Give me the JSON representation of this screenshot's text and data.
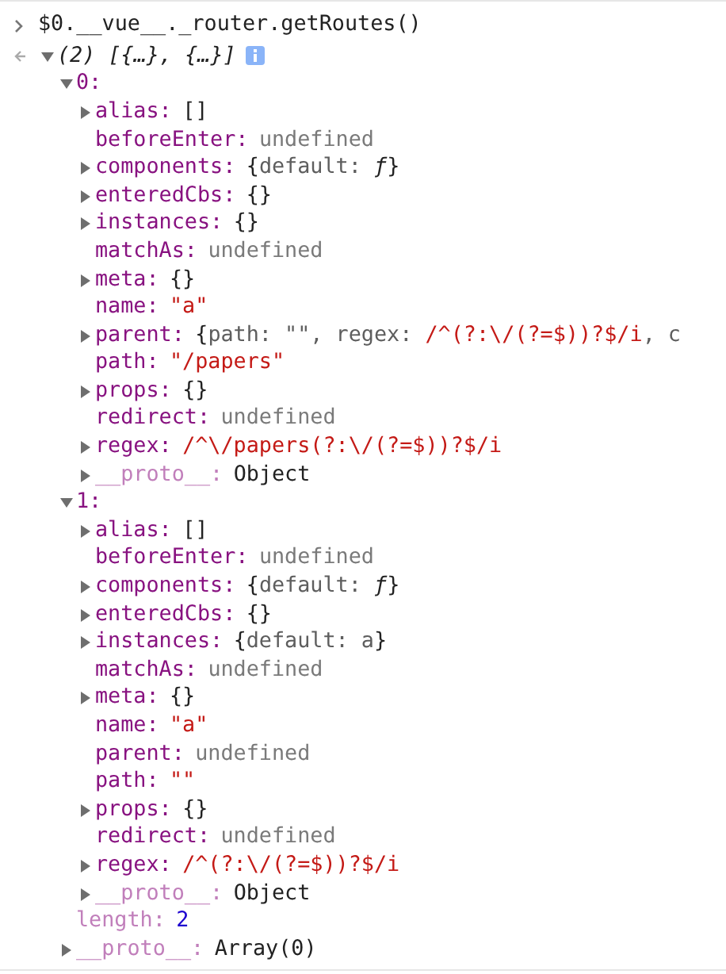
{
  "console": {
    "command": "$0.__vue__._router.getRoutes()",
    "result": {
      "summary": "(2) [{…}, {…}]",
      "expanded": true,
      "children": [
        {
          "key": "0:",
          "expanded": true,
          "dim": false,
          "children": [
            {
              "key": "alias:",
              "expanded": false,
              "dim": false,
              "value": [
                {
                  "text": "[]",
                  "kind": "plain"
                }
              ]
            },
            {
              "key": "beforeEnter:",
              "dim": false,
              "value": [
                {
                  "text": "undefined",
                  "kind": "undefined"
                }
              ]
            },
            {
              "key": "components:",
              "expanded": false,
              "dim": false,
              "value": [
                {
                  "text": "{",
                  "kind": "plain"
                },
                {
                  "text": "default: ",
                  "kind": "preview"
                },
                {
                  "text": "ƒ",
                  "kind": "function"
                },
                {
                  "text": "}",
                  "kind": "plain"
                }
              ]
            },
            {
              "key": "enteredCbs:",
              "expanded": false,
              "dim": false,
              "value": [
                {
                  "text": "{}",
                  "kind": "plain"
                }
              ]
            },
            {
              "key": "instances:",
              "expanded": false,
              "dim": false,
              "value": [
                {
                  "text": "{}",
                  "kind": "plain"
                }
              ]
            },
            {
              "key": "matchAs:",
              "dim": false,
              "value": [
                {
                  "text": "undefined",
                  "kind": "undefined"
                }
              ]
            },
            {
              "key": "meta:",
              "expanded": false,
              "dim": false,
              "value": [
                {
                  "text": "{}",
                  "kind": "plain"
                }
              ]
            },
            {
              "key": "name:",
              "dim": false,
              "value": [
                {
                  "text": "\"a\"",
                  "kind": "string"
                }
              ]
            },
            {
              "key": "parent:",
              "expanded": false,
              "dim": false,
              "value": [
                {
                  "text": "{",
                  "kind": "plain"
                },
                {
                  "text": "path: \"\", regex: ",
                  "kind": "preview"
                },
                {
                  "text": "/^(?:\\/(?=$))?$/i",
                  "kind": "regex"
                },
                {
                  "text": ", c",
                  "kind": "preview"
                }
              ]
            },
            {
              "key": "path:",
              "dim": false,
              "value": [
                {
                  "text": "\"/papers\"",
                  "kind": "string"
                }
              ]
            },
            {
              "key": "props:",
              "expanded": false,
              "dim": false,
              "value": [
                {
                  "text": "{}",
                  "kind": "plain"
                }
              ]
            },
            {
              "key": "redirect:",
              "dim": false,
              "value": [
                {
                  "text": "undefined",
                  "kind": "undefined"
                }
              ]
            },
            {
              "key": "regex:",
              "expanded": false,
              "dim": false,
              "value": [
                {
                  "text": "/^\\/papers(?:\\/(?=$))?$/i",
                  "kind": "regex"
                }
              ]
            },
            {
              "key": "__proto__:",
              "expanded": false,
              "dim": true,
              "value": [
                {
                  "text": "Object",
                  "kind": "plain"
                }
              ]
            }
          ]
        },
        {
          "key": "1:",
          "expanded": true,
          "dim": false,
          "children": [
            {
              "key": "alias:",
              "expanded": false,
              "dim": false,
              "value": [
                {
                  "text": "[]",
                  "kind": "plain"
                }
              ]
            },
            {
              "key": "beforeEnter:",
              "dim": false,
              "value": [
                {
                  "text": "undefined",
                  "kind": "undefined"
                }
              ]
            },
            {
              "key": "components:",
              "expanded": false,
              "dim": false,
              "value": [
                {
                  "text": "{",
                  "kind": "plain"
                },
                {
                  "text": "default: ",
                  "kind": "preview"
                },
                {
                  "text": "ƒ",
                  "kind": "function"
                },
                {
                  "text": "}",
                  "kind": "plain"
                }
              ]
            },
            {
              "key": "enteredCbs:",
              "expanded": false,
              "dim": false,
              "value": [
                {
                  "text": "{}",
                  "kind": "plain"
                }
              ]
            },
            {
              "key": "instances:",
              "expanded": false,
              "dim": false,
              "value": [
                {
                  "text": "{",
                  "kind": "plain"
                },
                {
                  "text": "default: a",
                  "kind": "preview"
                },
                {
                  "text": "}",
                  "kind": "plain"
                }
              ]
            },
            {
              "key": "matchAs:",
              "dim": false,
              "value": [
                {
                  "text": "undefined",
                  "kind": "undefined"
                }
              ]
            },
            {
              "key": "meta:",
              "expanded": false,
              "dim": false,
              "value": [
                {
                  "text": "{}",
                  "kind": "plain"
                }
              ]
            },
            {
              "key": "name:",
              "dim": false,
              "value": [
                {
                  "text": "\"a\"",
                  "kind": "string"
                }
              ]
            },
            {
              "key": "parent:",
              "dim": false,
              "value": [
                {
                  "text": "undefined",
                  "kind": "undefined"
                }
              ]
            },
            {
              "key": "path:",
              "dim": false,
              "value": [
                {
                  "text": "\"\"",
                  "kind": "string"
                }
              ]
            },
            {
              "key": "props:",
              "expanded": false,
              "dim": false,
              "value": [
                {
                  "text": "{}",
                  "kind": "plain"
                }
              ]
            },
            {
              "key": "redirect:",
              "dim": false,
              "value": [
                {
                  "text": "undefined",
                  "kind": "undefined"
                }
              ]
            },
            {
              "key": "regex:",
              "expanded": false,
              "dim": false,
              "value": [
                {
                  "text": "/^(?:\\/(?=$))?$/i",
                  "kind": "regex"
                }
              ]
            },
            {
              "key": "__proto__:",
              "expanded": false,
              "dim": true,
              "value": [
                {
                  "text": "Object",
                  "kind": "plain"
                }
              ]
            }
          ]
        },
        {
          "key": "length:",
          "dim": true,
          "value": [
            {
              "text": "2",
              "kind": "number"
            }
          ]
        },
        {
          "key": "__proto__:",
          "expanded": false,
          "dim": true,
          "value": [
            {
              "text": "Array(0)",
              "kind": "plain"
            }
          ]
        }
      ]
    }
  }
}
